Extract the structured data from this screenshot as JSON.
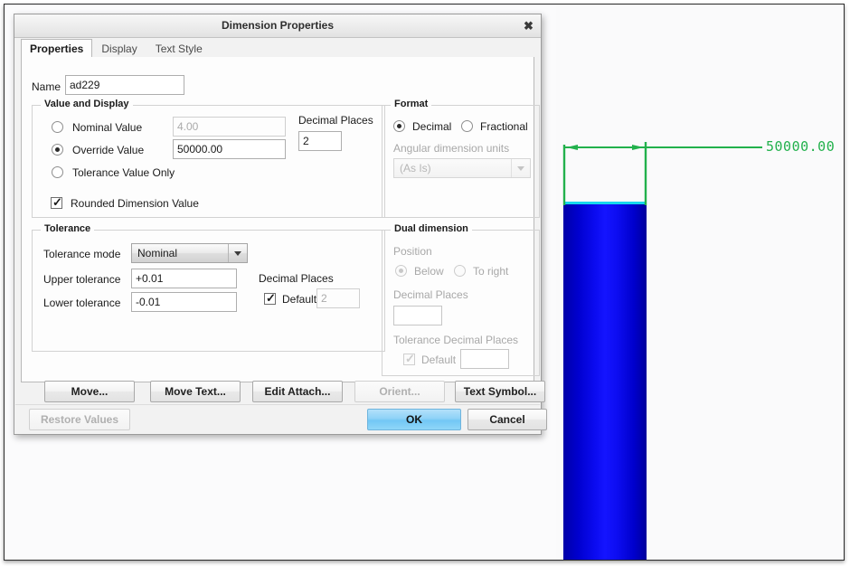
{
  "dialog": {
    "title": "Dimension Properties",
    "close_icon": "close-icon",
    "tabs": [
      {
        "label": "Properties",
        "active": true
      },
      {
        "label": "Display",
        "active": false
      },
      {
        "label": "Text Style",
        "active": false
      }
    ],
    "name_label": "Name",
    "name_value": "ad229",
    "value_display": {
      "title": "Value and Display",
      "options": [
        {
          "label": "Nominal Value",
          "selected": false
        },
        {
          "label": "Override Value",
          "selected": true
        },
        {
          "label": "Tolerance Value Only",
          "selected": false
        }
      ],
      "nominal_value": "4.00",
      "override_value": "50000.00",
      "decimal_places_label": "Decimal Places",
      "decimal_places_value": "2",
      "rounded_label": "Rounded Dimension Value",
      "rounded_checked": true
    },
    "format": {
      "title": "Format",
      "decimal_label": "Decimal",
      "decimal_selected": true,
      "fractional_label": "Fractional",
      "fractional_selected": false,
      "angular_label": "Angular dimension units",
      "angular_value": "(As Is)"
    },
    "tolerance": {
      "title": "Tolerance",
      "mode_label": "Tolerance mode",
      "mode_value": "Nominal",
      "upper_label": "Upper tolerance",
      "upper_value": "+0.01",
      "lower_label": "Lower tolerance",
      "lower_value": "-0.01",
      "decimal_places_label": "Decimal Places",
      "default_label": "Default",
      "default_checked": true,
      "default_value": "2"
    },
    "dual_dimension": {
      "title": "Dual dimension",
      "position_label": "Position",
      "below_label": "Below",
      "below_selected": true,
      "to_right_label": "To right",
      "to_right_selected": false,
      "decimal_places_label": "Decimal Places",
      "decimal_places_value": "",
      "tol_decimal_places_label": "Tolerance Decimal Places",
      "tol_default_label": "Default",
      "tol_default_checked": true,
      "tol_default_value": ""
    },
    "buttons": {
      "move": "Move...",
      "move_text": "Move Text...",
      "edit_attach": "Edit Attach...",
      "orient": "Orient...",
      "text_symbol": "Text Symbol...",
      "restore_values": "Restore Values",
      "ok": "OK",
      "cancel": "Cancel"
    }
  },
  "viewport": {
    "dimension_text": "50000.00",
    "dimension_color": "#22b14c",
    "part_color": "#1414ff",
    "part_edge_color": "#17d6ee"
  }
}
